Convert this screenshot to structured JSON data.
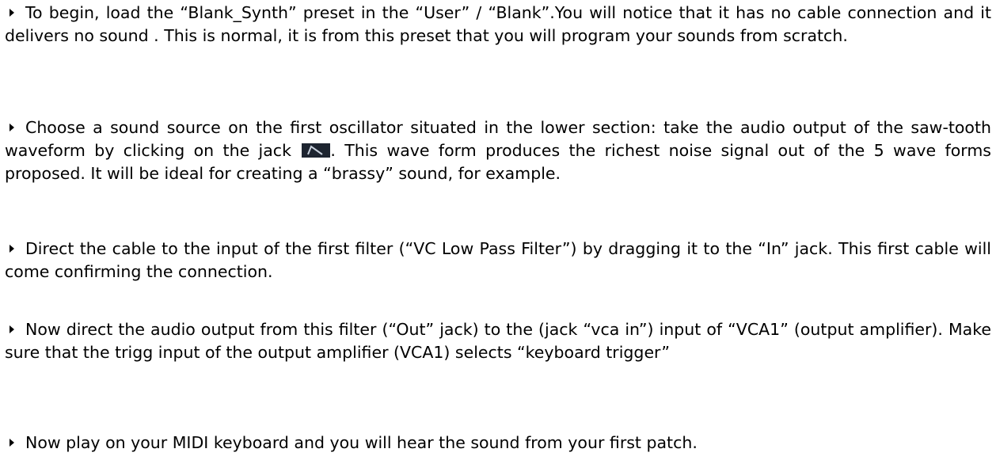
{
  "paragraphs": [
    {
      "id": "p1",
      "text": "To begin, load the “Blank_Synth” preset in the “User” / “Blank”.You will notice that it has no cable connection and it delivers no sound . This is normal, it is from this preset that you will program your sounds from scratch."
    },
    {
      "id": "p2",
      "text_before": "Choose a sound source on the first oscillator situated in the lower section: take the audio output of the saw-tooth waveform by clicking on the jack",
      "icon": "sawtooth-jack-icon",
      "text_after": ". This wave form produces the richest noise signal out of the 5 wave forms proposed. It will be ideal for creating a “brassy” sound, for example."
    },
    {
      "id": "p3",
      "text": "Direct the cable to the input of the first filter (“VC Low Pass Filter”) by dragging it to the “In” jack. This first cable will come confirming the connection."
    },
    {
      "id": "p4",
      "text": "Now direct the audio output from this filter (“Out” jack) to the (jack “vca in”) input of “VCA1” (output amplifier). Make sure that the trigg input of the output amplifier (VCA1) selects “keyboard trigger”"
    },
    {
      "id": "p5",
      "text": "Now play on your MIDI keyboard and you will hear the sound from your first patch."
    }
  ],
  "colors": {
    "text": "#000000",
    "icon_bg": "#1d2430",
    "icon_stroke": "#c8d0dc"
  }
}
